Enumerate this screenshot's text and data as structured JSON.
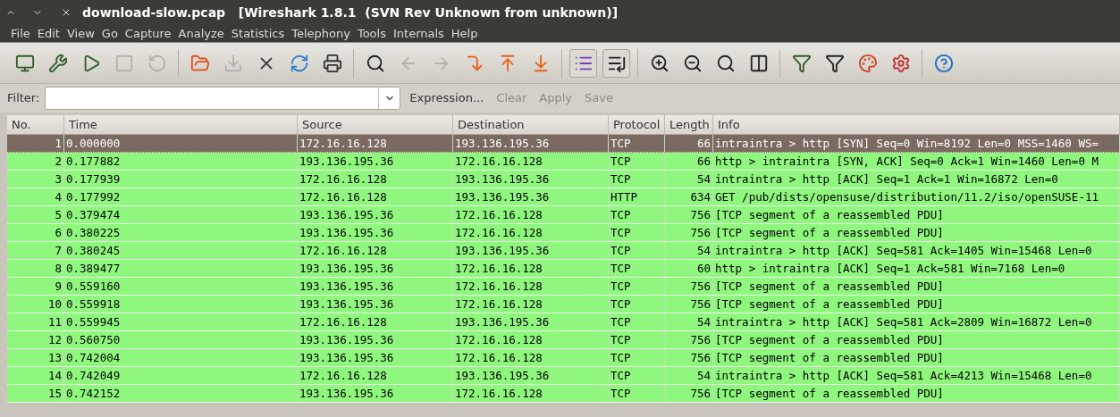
{
  "window": {
    "title": "download-slow.pcap   [Wireshark 1.8.1  (SVN Rev Unknown from unknown)]"
  },
  "menu": [
    "File",
    "Edit",
    "View",
    "Go",
    "Capture",
    "Analyze",
    "Statistics",
    "Telephony",
    "Tools",
    "Internals",
    "Help"
  ],
  "toolbar": [
    [
      {
        "kind": "interfaces",
        "disabled": false,
        "pressed": false
      },
      {
        "kind": "options",
        "disabled": false,
        "pressed": false
      },
      {
        "kind": "start",
        "disabled": false,
        "pressed": false
      },
      {
        "kind": "stop",
        "disabled": true,
        "pressed": false
      },
      {
        "kind": "restart",
        "disabled": true,
        "pressed": false
      }
    ],
    [
      {
        "kind": "open",
        "disabled": false,
        "pressed": false
      },
      {
        "kind": "save",
        "disabled": true,
        "pressed": false
      },
      {
        "kind": "close",
        "disabled": false,
        "pressed": false
      },
      {
        "kind": "reload",
        "disabled": false,
        "pressed": false
      },
      {
        "kind": "print",
        "disabled": false,
        "pressed": false
      }
    ],
    [
      {
        "kind": "find",
        "disabled": false,
        "pressed": false
      },
      {
        "kind": "back",
        "disabled": true,
        "pressed": false
      },
      {
        "kind": "forward",
        "disabled": true,
        "pressed": false
      },
      {
        "kind": "goto",
        "disabled": false,
        "pressed": false
      },
      {
        "kind": "first",
        "disabled": false,
        "pressed": false
      },
      {
        "kind": "last",
        "disabled": false,
        "pressed": false
      }
    ],
    [
      {
        "kind": "colorize",
        "disabled": false,
        "pressed": true
      },
      {
        "kind": "autoscroll",
        "disabled": false,
        "pressed": true
      }
    ],
    [
      {
        "kind": "zoom-in",
        "disabled": false,
        "pressed": false
      },
      {
        "kind": "zoom-out",
        "disabled": false,
        "pressed": false
      },
      {
        "kind": "zoom-reset",
        "disabled": false,
        "pressed": false
      },
      {
        "kind": "resize",
        "disabled": false,
        "pressed": false
      }
    ],
    [
      {
        "kind": "capture-filter",
        "disabled": false,
        "pressed": false
      },
      {
        "kind": "display-filter",
        "disabled": false,
        "pressed": false
      },
      {
        "kind": "coloring",
        "disabled": false,
        "pressed": false
      },
      {
        "kind": "preferences",
        "disabled": false,
        "pressed": false
      }
    ],
    [
      {
        "kind": "help",
        "disabled": false,
        "pressed": false
      }
    ]
  ],
  "filter": {
    "label": "Filter:",
    "buttons": [
      {
        "label": "Expression...",
        "disabled": false
      },
      {
        "label": "Clear",
        "disabled": true
      },
      {
        "label": "Apply",
        "disabled": true
      },
      {
        "label": "Save",
        "disabled": true
      }
    ]
  },
  "table": {
    "columns": [
      "No.",
      "Time",
      "Source",
      "Destination",
      "Protocol",
      "Length",
      "Info"
    ],
    "rows": [
      {
        "selected": true,
        "cells": [
          "1",
          "0.000000",
          "172.16.16.128",
          "193.136.195.36",
          "TCP",
          "66",
          "intraintra > http [SYN] Seq=0 Win=8192 Len=0 MSS=1460 WS="
        ]
      },
      {
        "selected": false,
        "cells": [
          "2",
          "0.177882",
          "193.136.195.36",
          "172.16.16.128",
          "TCP",
          "66",
          "http > intraintra [SYN, ACK] Seq=0 Ack=1 Win=1460 Len=0 M"
        ]
      },
      {
        "selected": false,
        "cells": [
          "3",
          "0.177939",
          "172.16.16.128",
          "193.136.195.36",
          "TCP",
          "54",
          "intraintra > http [ACK] Seq=1 Ack=1 Win=16872 Len=0"
        ]
      },
      {
        "selected": false,
        "cells": [
          "4",
          "0.177992",
          "172.16.16.128",
          "193.136.195.36",
          "HTTP",
          "634",
          "GET /pub/dists/opensuse/distribution/11.2/iso/openSUSE-11"
        ]
      },
      {
        "selected": false,
        "cells": [
          "5",
          "0.379474",
          "193.136.195.36",
          "172.16.16.128",
          "TCP",
          "756",
          "[TCP segment of a reassembled PDU]"
        ]
      },
      {
        "selected": false,
        "cells": [
          "6",
          "0.380225",
          "193.136.195.36",
          "172.16.16.128",
          "TCP",
          "756",
          "[TCP segment of a reassembled PDU]"
        ]
      },
      {
        "selected": false,
        "cells": [
          "7",
          "0.380245",
          "172.16.16.128",
          "193.136.195.36",
          "TCP",
          "54",
          "intraintra > http [ACK] Seq=581 Ack=1405 Win=15468 Len=0"
        ]
      },
      {
        "selected": false,
        "cells": [
          "8",
          "0.389477",
          "193.136.195.36",
          "172.16.16.128",
          "TCP",
          "60",
          "http > intraintra [ACK] Seq=1 Ack=581 Win=7168 Len=0"
        ]
      },
      {
        "selected": false,
        "cells": [
          "9",
          "0.559160",
          "193.136.195.36",
          "172.16.16.128",
          "TCP",
          "756",
          "[TCP segment of a reassembled PDU]"
        ]
      },
      {
        "selected": false,
        "cells": [
          "10",
          "0.559918",
          "193.136.195.36",
          "172.16.16.128",
          "TCP",
          "756",
          "[TCP segment of a reassembled PDU]"
        ]
      },
      {
        "selected": false,
        "cells": [
          "11",
          "0.559945",
          "172.16.16.128",
          "193.136.195.36",
          "TCP",
          "54",
          "intraintra > http [ACK] Seq=581 Ack=2809 Win=16872 Len=0"
        ]
      },
      {
        "selected": false,
        "cells": [
          "12",
          "0.560750",
          "193.136.195.36",
          "172.16.16.128",
          "TCP",
          "756",
          "[TCP segment of a reassembled PDU]"
        ]
      },
      {
        "selected": false,
        "cells": [
          "13",
          "0.742004",
          "193.136.195.36",
          "172.16.16.128",
          "TCP",
          "756",
          "[TCP segment of a reassembled PDU]"
        ]
      },
      {
        "selected": false,
        "cells": [
          "14",
          "0.742049",
          "172.16.16.128",
          "193.136.195.36",
          "TCP",
          "54",
          "intraintra > http [ACK] Seq=581 Ack=4213 Win=15468 Len=0"
        ]
      },
      {
        "selected": false,
        "cells": [
          "15",
          "0.742152",
          "193.136.195.36",
          "172.16.16.128",
          "TCP",
          "756",
          "[TCP segment of a reassembled PDU]"
        ]
      }
    ]
  }
}
